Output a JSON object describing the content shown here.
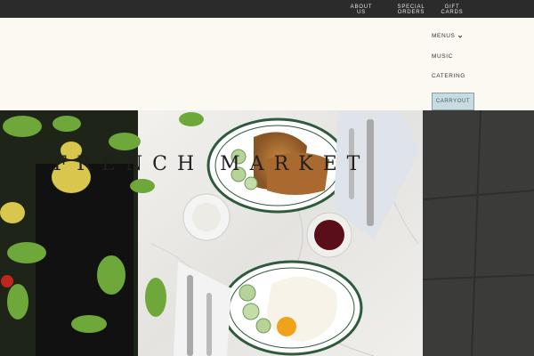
{
  "topbar": {
    "about_label": "ABOUT\nUS",
    "special_label": "SPECIAL\nORDERS",
    "gift_label": "GIFT\nCARDS"
  },
  "nav": {
    "menus_label": "MENUS",
    "music_label": "MUSIC",
    "catering_label": "CATERING",
    "carryout_label": "CARRYOUT"
  },
  "hero": {
    "title": "FRENCH MARKET"
  },
  "colors": {
    "topbar": "#2b2b2b",
    "header_bg": "#fbf9f1",
    "carryout_bg": "#c8dcdf",
    "carryout_border": "#7fa1a8"
  },
  "icons": {
    "menus_dropdown": "chevron-down-icon"
  }
}
